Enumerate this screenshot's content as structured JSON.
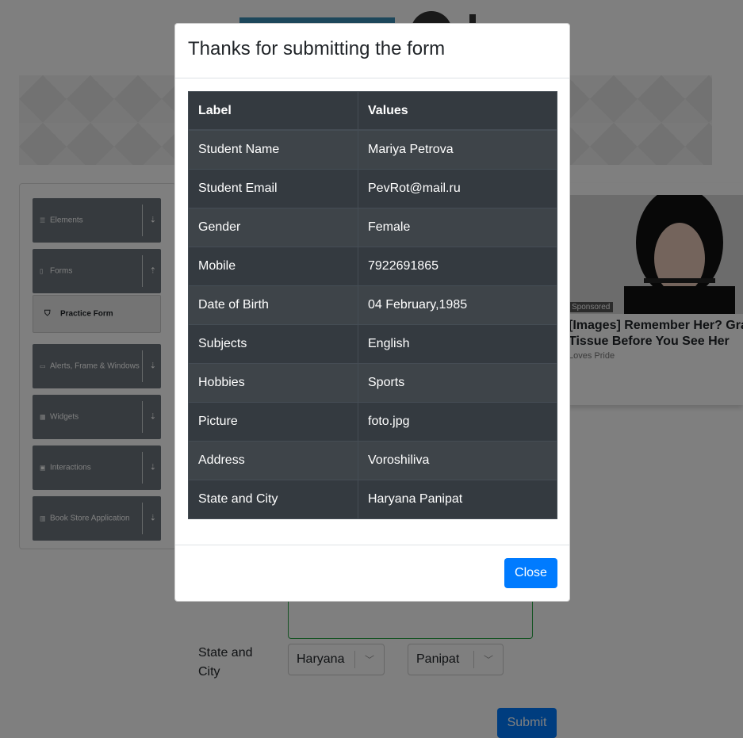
{
  "sidebar": {
    "groups": [
      {
        "icon": "list-icon",
        "label": "Elements"
      },
      {
        "icon": "document-icon",
        "label": "Forms"
      },
      {
        "icon": "window-icon",
        "label": "Alerts, Frame & Windows"
      },
      {
        "icon": "grid-icon",
        "label": "Widgets"
      },
      {
        "icon": "box-icon",
        "label": "Interactions"
      },
      {
        "icon": "book-icon",
        "label": "Book Store Application"
      }
    ],
    "active_item": {
      "icon": "html5-icon",
      "label": "Practice Form"
    }
  },
  "ad": {
    "sponsored": "Sponsored",
    "title_line1": "[Images] Remember Her? Gra",
    "title_line2": "Tissue Before You See Her",
    "source": "Loves Pride"
  },
  "form": {
    "state_label": "State and City",
    "state_value": "Haryana",
    "city_value": "Panipat",
    "submit_label": "Submit"
  },
  "modal": {
    "title": "Thanks for submitting the form",
    "headers": [
      "Label",
      "Values"
    ],
    "rows": [
      [
        "Student Name",
        "Mariya Petrova"
      ],
      [
        "Student Email",
        "PevRot@mail.ru"
      ],
      [
        "Gender",
        "Female"
      ],
      [
        "Mobile",
        "7922691865"
      ],
      [
        "Date of Birth",
        "04 February,1985"
      ],
      [
        "Subjects",
        "English"
      ],
      [
        "Hobbies",
        "Sports"
      ],
      [
        "Picture",
        "foto.jpg"
      ],
      [
        "Address",
        "Voroshiliva"
      ],
      [
        "State and City",
        "Haryana Panipat"
      ]
    ],
    "close_label": "Close"
  }
}
